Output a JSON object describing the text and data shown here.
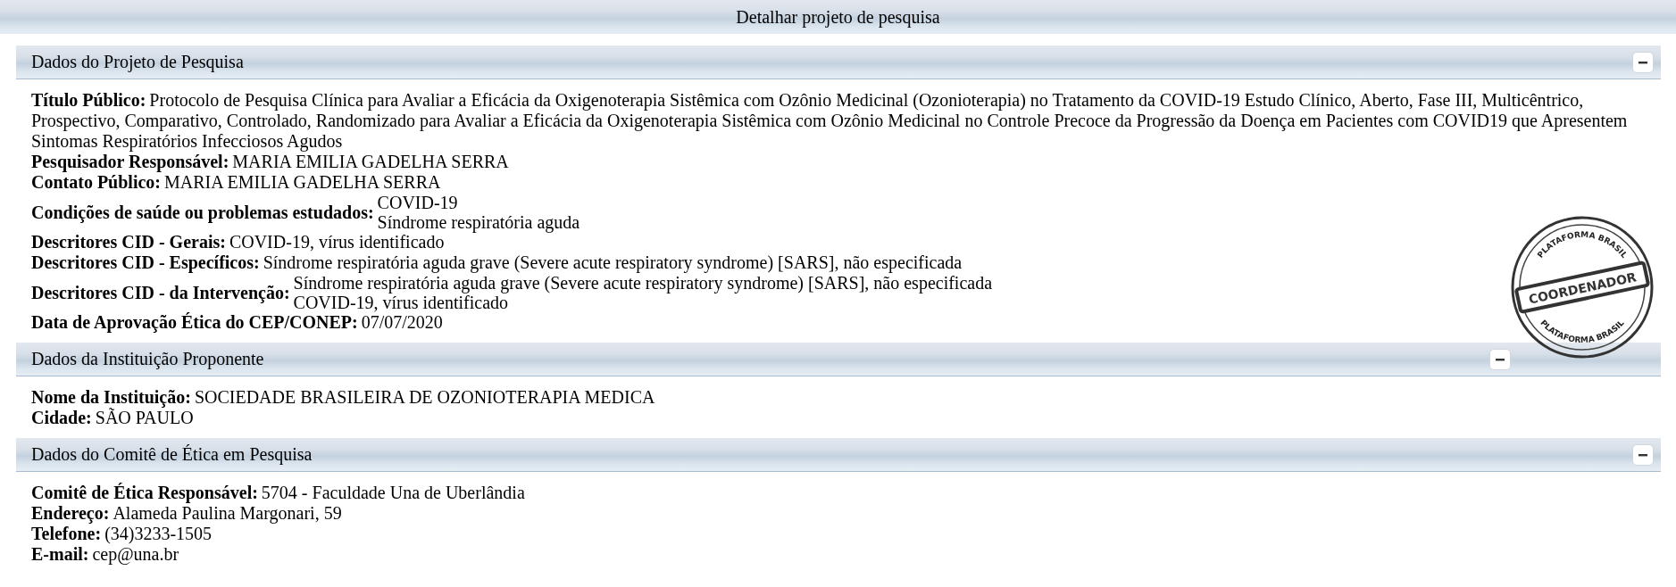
{
  "page_title": "Detalhar projeto de pesquisa",
  "sections": [
    {
      "title": "Dados do Projeto de Pesquisa",
      "expanded": true,
      "fields": [
        {
          "label": "Título Público:",
          "values": [
            "Protocolo de Pesquisa Clínica para Avaliar a Eficácia da Oxigenoterapia Sistêmica com Ozônio Medicinal (Ozonioterapia) no Tratamento da COVID-19 Estudo Clínico, Aberto, Fase III, Multicêntrico, Prospectivo, Comparativo, Controlado, Randomizado para Avaliar a Eficácia da Oxigenoterapia Sistêmica com Ozônio Medicinal no Controle Precoce da Progressão da Doença em Pacientes com COVID19 que Apresentem Sintomas Respiratórios Infecciosos Agudos"
          ]
        },
        {
          "label": "Pesquisador Responsável:",
          "values": [
            "MARIA EMILIA GADELHA SERRA"
          ]
        },
        {
          "label": "Contato Público:",
          "values": [
            "MARIA EMILIA GADELHA SERRA"
          ]
        },
        {
          "label": "Condições de saúde ou problemas estudados:",
          "values": [
            "COVID-19",
            "Síndrome respiratória aguda"
          ]
        },
        {
          "label": "Descritores CID - Gerais:",
          "values": [
            "COVID-19, vírus identificado"
          ]
        },
        {
          "label": "Descritores CID - Específicos:",
          "values": [
            "Síndrome respiratória aguda grave (Severe acute respiratory syndrome) [SARS], não especificada"
          ]
        },
        {
          "label": "Descritores CID - da Intervenção:",
          "values": [
            "Síndrome respiratória aguda grave (Severe acute respiratory syndrome) [SARS], não especificada",
            "COVID-19, vírus identificado"
          ]
        },
        {
          "label": "Data de Aprovação Ética do CEP/CONEP:",
          "values": [
            "07/07/2020"
          ]
        }
      ],
      "stamp": {
        "ring_top": "PLATAFORMA BRASIL",
        "ring_bottom": "PLATAFORMA BRASIL",
        "label": "COORDENADOR"
      }
    },
    {
      "title": "Dados da Instituição Proponente",
      "expanded": true,
      "fields": [
        {
          "label": "Nome da Instituição:",
          "values": [
            "SOCIEDADE BRASILEIRA DE OZONIOTERAPIA MEDICA"
          ]
        },
        {
          "label": "Cidade:",
          "values": [
            "SÃO PAULO"
          ]
        }
      ]
    },
    {
      "title": "Dados do Comitê de Ética em Pesquisa",
      "expanded": true,
      "fields": [
        {
          "label": "Comitê de Ética Responsável:",
          "values": [
            "5704 - Faculdade Una de Uberlândia"
          ]
        },
        {
          "label": "Endereço:",
          "values": [
            "Alameda Paulina Margonari, 59"
          ]
        },
        {
          "label": "Telefone:",
          "values": [
            "(34)3233-1505"
          ]
        },
        {
          "label": "E-mail:",
          "values": [
            "cep@una.br"
          ]
        }
      ]
    }
  ]
}
